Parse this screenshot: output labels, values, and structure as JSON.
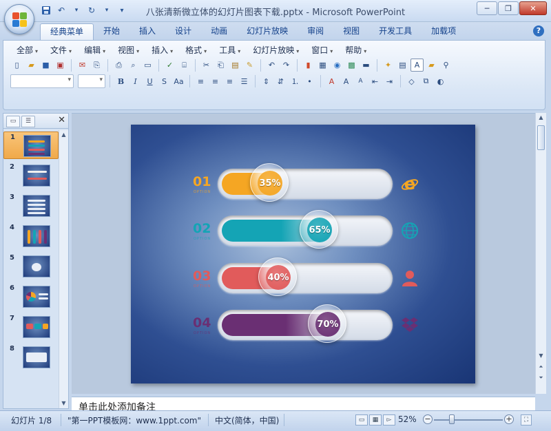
{
  "window": {
    "title": "八张清新微立体的幻灯片图表下载.pptx - Microsoft PowerPoint",
    "minimize": "─",
    "restore": "❐",
    "close": "✕"
  },
  "ribbon_tabs": [
    "经典菜单",
    "开始",
    "插入",
    "设计",
    "动画",
    "幻灯片放映",
    "审阅",
    "视图",
    "开发工具",
    "加载项"
  ],
  "help_label": "?",
  "menus": [
    "全部",
    "文件",
    "编辑",
    "视图",
    "插入",
    "格式",
    "工具",
    "幻灯片放映",
    "窗口",
    "帮助"
  ],
  "thumbnails": [
    {
      "num": "1",
      "selected": true
    },
    {
      "num": "2",
      "selected": false
    },
    {
      "num": "3",
      "selected": false
    },
    {
      "num": "4",
      "selected": false
    },
    {
      "num": "5",
      "selected": false
    },
    {
      "num": "6",
      "selected": false
    },
    {
      "num": "7",
      "selected": false
    },
    {
      "num": "8",
      "selected": false
    }
  ],
  "slide": {
    "rows": [
      {
        "num": "01",
        "option": "OPTION",
        "percent": "35%",
        "fraction": 0.35,
        "color": "#f5a623",
        "icon": "internet-explorer-icon"
      },
      {
        "num": "02",
        "option": "OPTION",
        "percent": "65%",
        "fraction": 0.65,
        "color": "#14a4b5",
        "icon": "globe-icon"
      },
      {
        "num": "03",
        "option": "OPTION",
        "percent": "40%",
        "fraction": 0.4,
        "color": "#e15b5b",
        "icon": "user-icon"
      },
      {
        "num": "04",
        "option": "OPTION",
        "percent": "70%",
        "fraction": 0.7,
        "color": "#6a2f73",
        "icon": "dropbox-icon"
      }
    ]
  },
  "notes_placeholder": "单击此处添加备注",
  "status": {
    "slide_indicator": "幻灯片 1/8",
    "theme": "\"第一PPT模板网：www.1ppt.com\"",
    "language": "中文(简体，中国)",
    "zoom": "52%"
  }
}
